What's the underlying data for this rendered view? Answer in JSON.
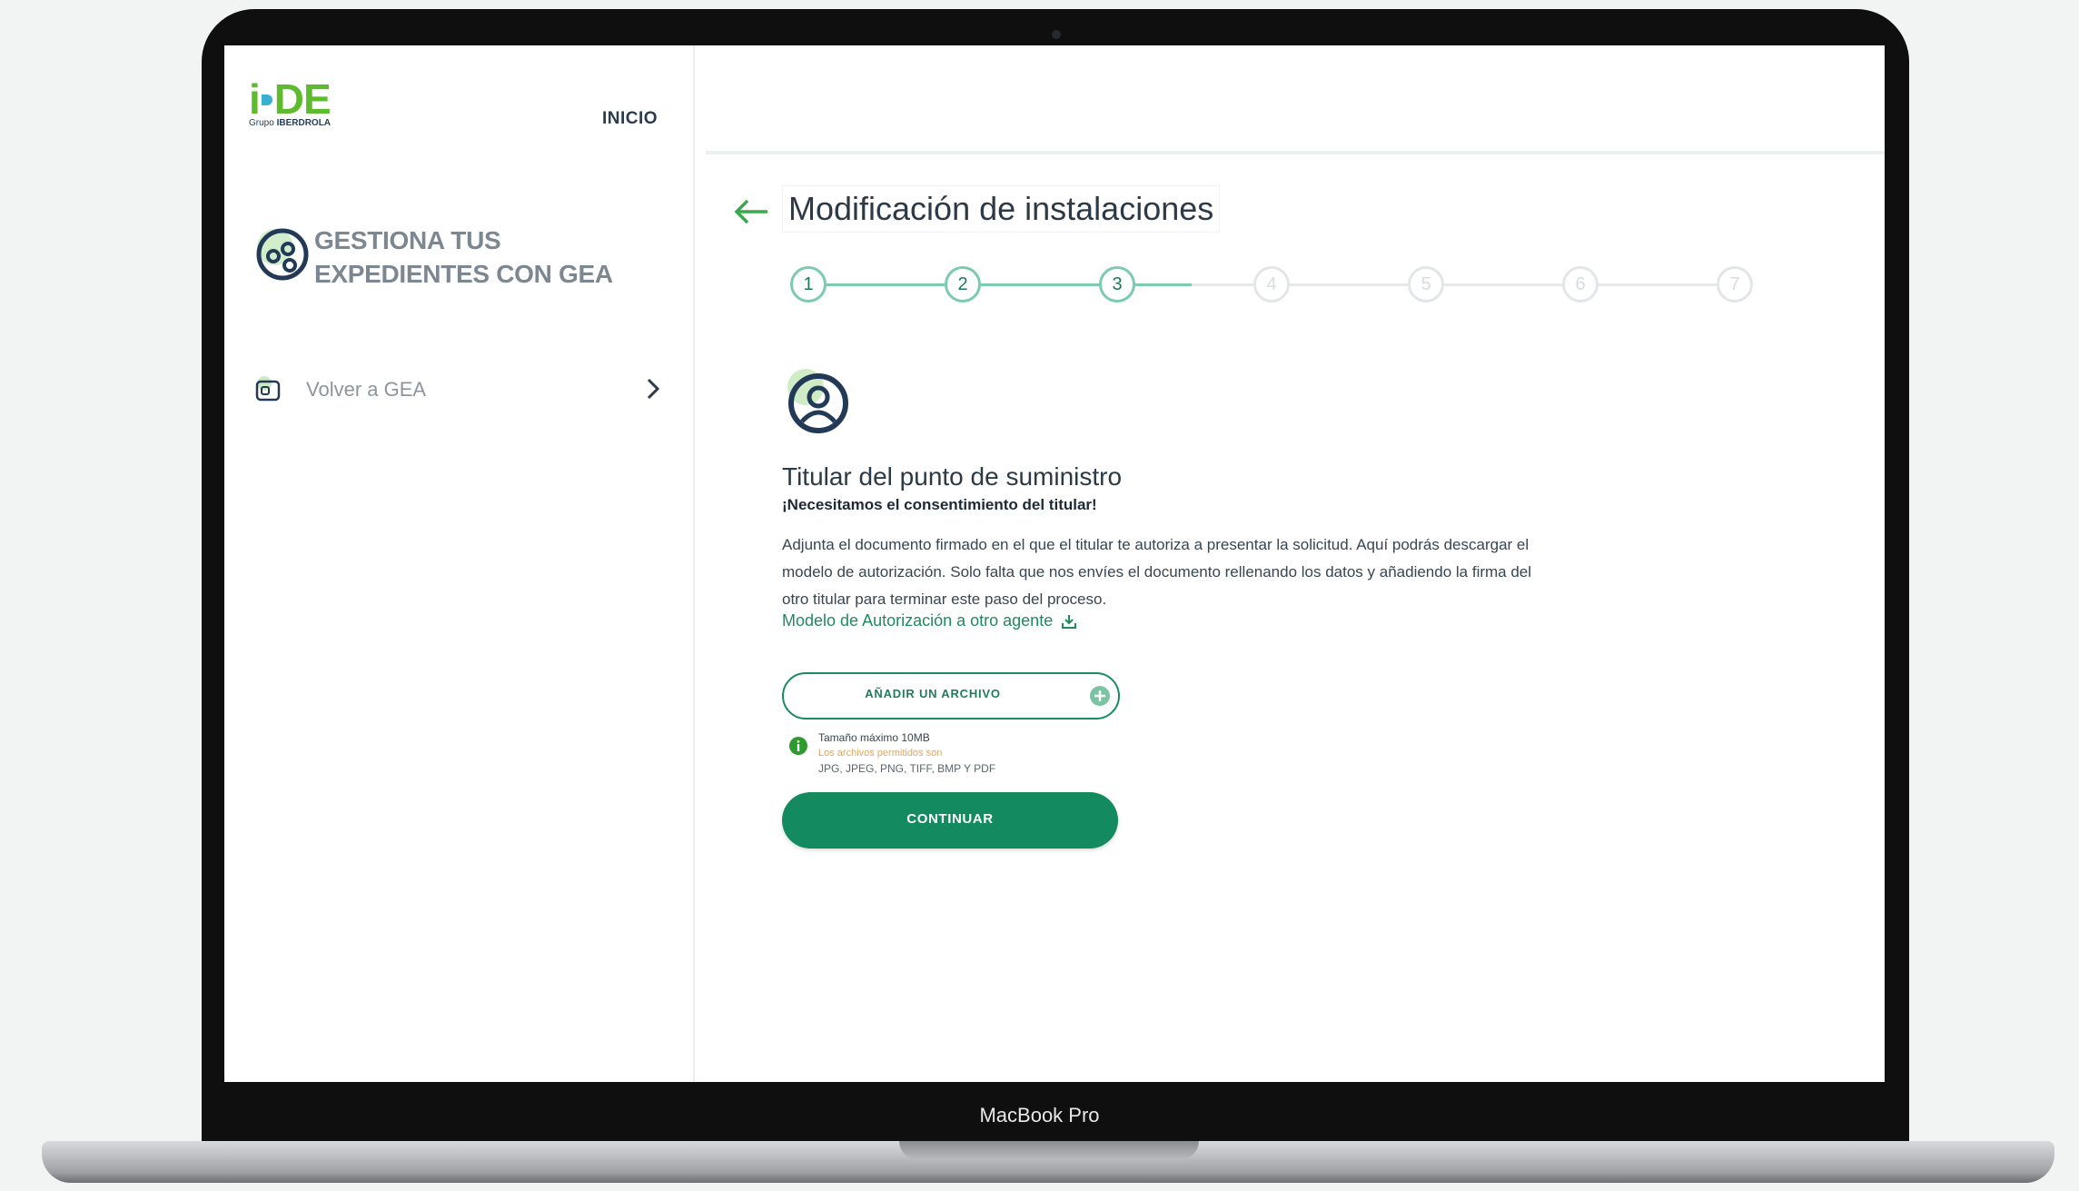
{
  "device": {
    "label": "MacBook Pro"
  },
  "sidebar": {
    "logo_text": "i-DE",
    "logo_sub_prefix": "Grupo",
    "logo_sub_brand": "IBERDROLA",
    "nav_home": "INICIO",
    "section_title": "GESTIONA TUS EXPEDIENTES CON GEA",
    "back_link": "Volver a GEA"
  },
  "main": {
    "page_title": "Modificación de instalaciones",
    "steps": [
      {
        "label": "1",
        "status": "done"
      },
      {
        "label": "2",
        "status": "done"
      },
      {
        "label": "3",
        "status": "current"
      },
      {
        "label": "4",
        "status": "todo"
      },
      {
        "label": "5",
        "status": "todo"
      },
      {
        "label": "6",
        "status": "todo"
      },
      {
        "label": "7",
        "status": "todo"
      }
    ],
    "section_title": "Titular del punto de suministro",
    "section_subtitle": "¡Necesitamos el consentimiento del titular!",
    "section_body": "Adjunta el documento firmado en el que el titular te autoriza a presentar la solicitud. Aquí podrás descargar el modelo de autorización. Solo falta que nos envíes el documento rellenando los datos y añadiendo la firma del otro titular para terminar este paso del proceso.",
    "download_link": "Modelo de Autorización a otro agente",
    "add_file_label": "AÑADIR UN ARCHIVO",
    "file_info": {
      "max_size": "Tamaño máximo 10MB",
      "allowed_label": "Los archivos permitidos son",
      "allowed_types": "JPG, JPEG, PNG, TIFF, BMP Y PDF"
    },
    "continue_label": "CONTINUAR"
  },
  "colors": {
    "brand_green": "#5dbb2d",
    "primary": "#138a5f",
    "step_active": "#7ccbb1",
    "step_inactive": "#e3e6e8",
    "text_dark": "#2d3a46"
  },
  "icons": {
    "gea": "gea-people-icon",
    "back_gea": "app-icon",
    "chevron": "chevron-right-icon",
    "back": "arrow-left-icon",
    "user": "user-circle-icon",
    "download": "download-icon",
    "add": "plus-circle-icon",
    "info": "info-icon"
  }
}
